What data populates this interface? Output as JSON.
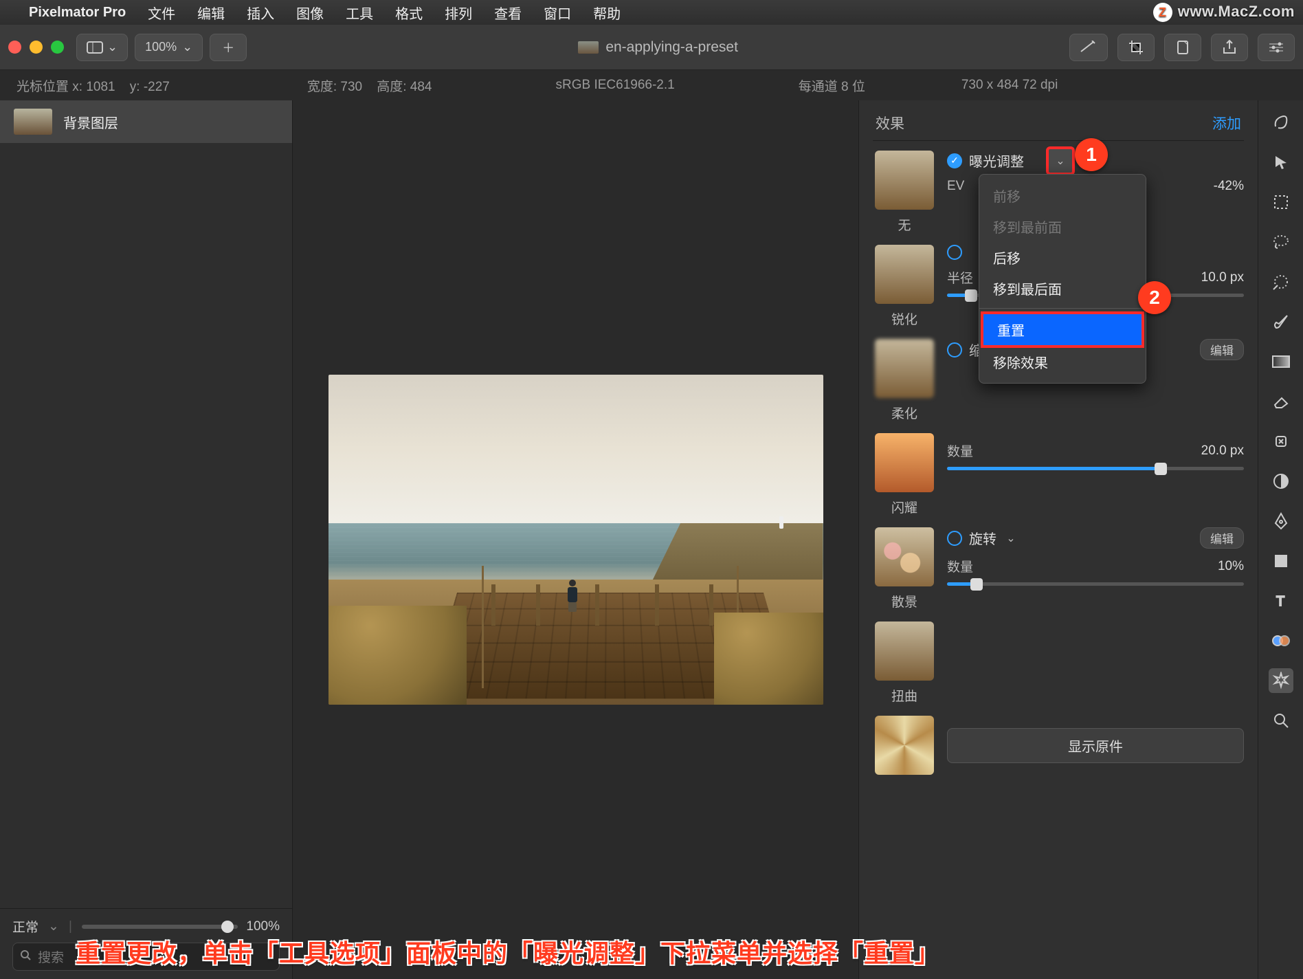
{
  "menubar": {
    "app": "Pixelmator Pro",
    "items": [
      "文件",
      "编辑",
      "插入",
      "图像",
      "工具",
      "格式",
      "排列",
      "查看",
      "窗口",
      "帮助"
    ],
    "watermark": "www.MacZ.com"
  },
  "toolbar": {
    "zoom": "100%",
    "doc_title": "en-applying-a-preset"
  },
  "infobar": {
    "cursor_label": "光标位置 x:",
    "cursor_x": "1081",
    "cursor_yl": "y:",
    "cursor_y": "-227",
    "width_label": "宽度:",
    "width": "730",
    "height_label": "高度:",
    "height": "484",
    "colorspace": "sRGB IEC61966-2.1",
    "depth": "每通道 8 位",
    "dims": "730 x 484 72 dpi"
  },
  "layers": {
    "item": "背景图层",
    "blend": "正常",
    "opacity": "100%",
    "search_ph": "搜索"
  },
  "inspector": {
    "title": "效果",
    "add": "添加",
    "none": "无",
    "exposure": {
      "name": "曝光调整",
      "param_label": "EV",
      "value": "-42%"
    },
    "sharpen": {
      "name": "锐化"
    },
    "soften_thumb": "柔化",
    "soften": {
      "param_label": "半径",
      "value": "10.0 px"
    },
    "zoom": {
      "name": "缩放",
      "edit": "编辑"
    },
    "flash": {
      "thumb": "闪耀",
      "param_label": "数量",
      "value": "20.0 px"
    },
    "rotate": {
      "name": "旋转",
      "edit": "编辑"
    },
    "bokeh": {
      "thumb": "散景",
      "param_label": "数量",
      "value": "10%"
    },
    "twist": {
      "thumb": "扭曲"
    },
    "show_original": "显示原件",
    "remove_effect": "移除效果"
  },
  "dropdown": {
    "move_fwd": "前移",
    "move_front": "移到最前面",
    "move_back": "后移",
    "move_last": "移到最后面",
    "reset": "重置"
  },
  "annot": {
    "n1": "1",
    "n2": "2"
  },
  "caption": "重置更改，单击「工具选项」面板中的「曝光调整」下拉菜单并选择「重置」"
}
